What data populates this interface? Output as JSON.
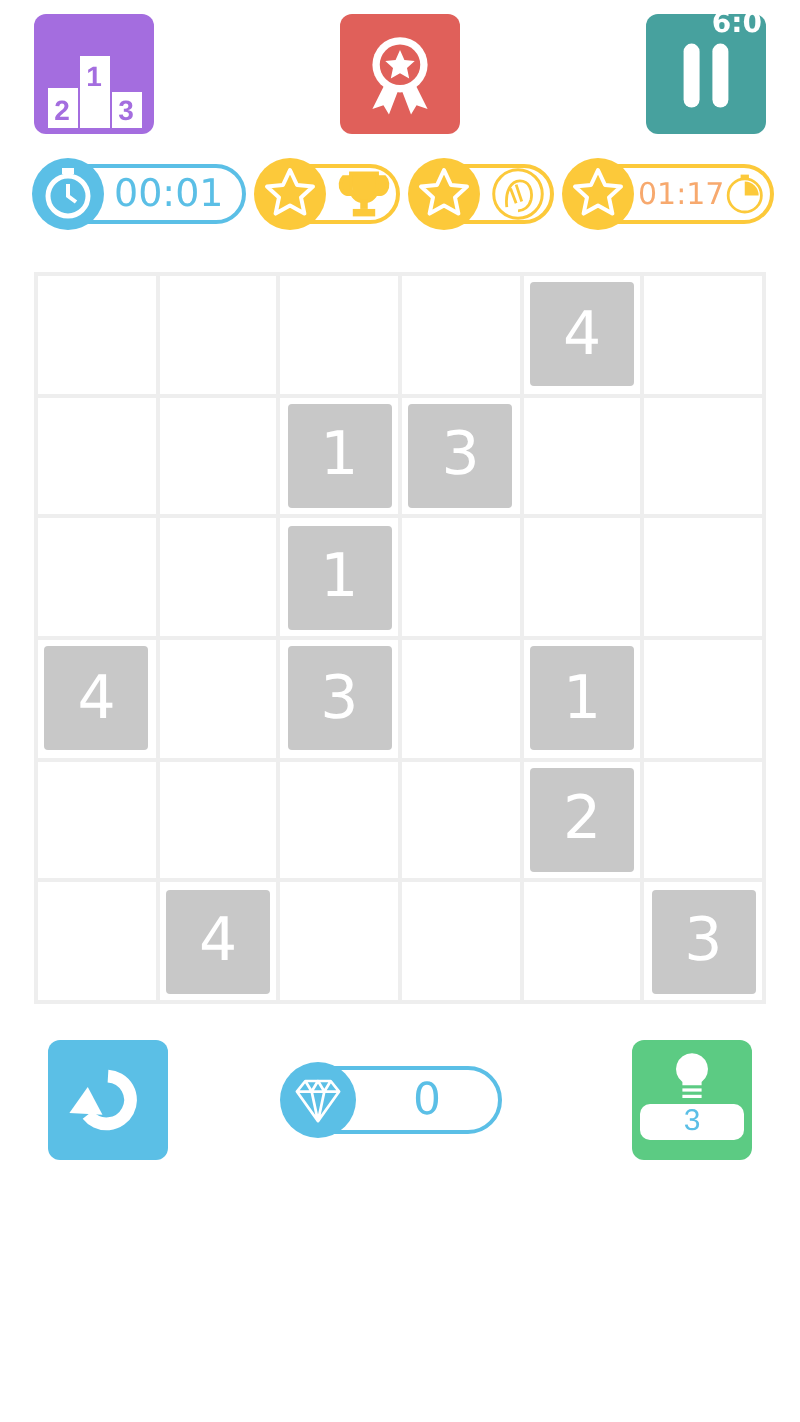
{
  "status_bar": {
    "time": "6:0"
  },
  "podium": {
    "places": [
      "2",
      "1",
      "3"
    ]
  },
  "timer": {
    "value": "00:01"
  },
  "goals": [
    {
      "kind": "trophy"
    },
    {
      "kind": "face"
    },
    {
      "kind": "time",
      "value": "01:17"
    }
  ],
  "grid": [
    {
      "cells": [
        {
          "filled": false
        },
        {
          "filled": false
        },
        {
          "filled": false
        },
        {
          "filled": false
        },
        {
          "filled": true,
          "number": "4"
        },
        {
          "filled": false
        }
      ]
    },
    {
      "cells": [
        {
          "filled": false
        },
        {
          "filled": false
        },
        {
          "filled": true,
          "number": "1"
        },
        {
          "filled": true,
          "number": "3"
        },
        {
          "filled": false
        },
        {
          "filled": false
        }
      ]
    },
    {
      "cells": [
        {
          "filled": false
        },
        {
          "filled": false
        },
        {
          "filled": true,
          "number": "1"
        },
        {
          "filled": false
        },
        {
          "filled": false
        },
        {
          "filled": false
        }
      ]
    },
    {
      "cells": [
        {
          "filled": true,
          "number": "4"
        },
        {
          "filled": false
        },
        {
          "filled": true,
          "number": "3"
        },
        {
          "filled": false
        },
        {
          "filled": true,
          "number": "1"
        },
        {
          "filled": false
        }
      ]
    },
    {
      "cells": [
        {
          "filled": false
        },
        {
          "filled": false
        },
        {
          "filled": false
        },
        {
          "filled": false
        },
        {
          "filled": true,
          "number": "2"
        },
        {
          "filled": false
        }
      ]
    },
    {
      "cells": [
        {
          "filled": false
        },
        {
          "filled": true,
          "number": "4"
        },
        {
          "filled": false
        },
        {
          "filled": false
        },
        {
          "filled": false
        },
        {
          "filled": true,
          "number": "3"
        }
      ]
    }
  ],
  "gems": {
    "count": "0"
  },
  "hint": {
    "count": "3"
  }
}
